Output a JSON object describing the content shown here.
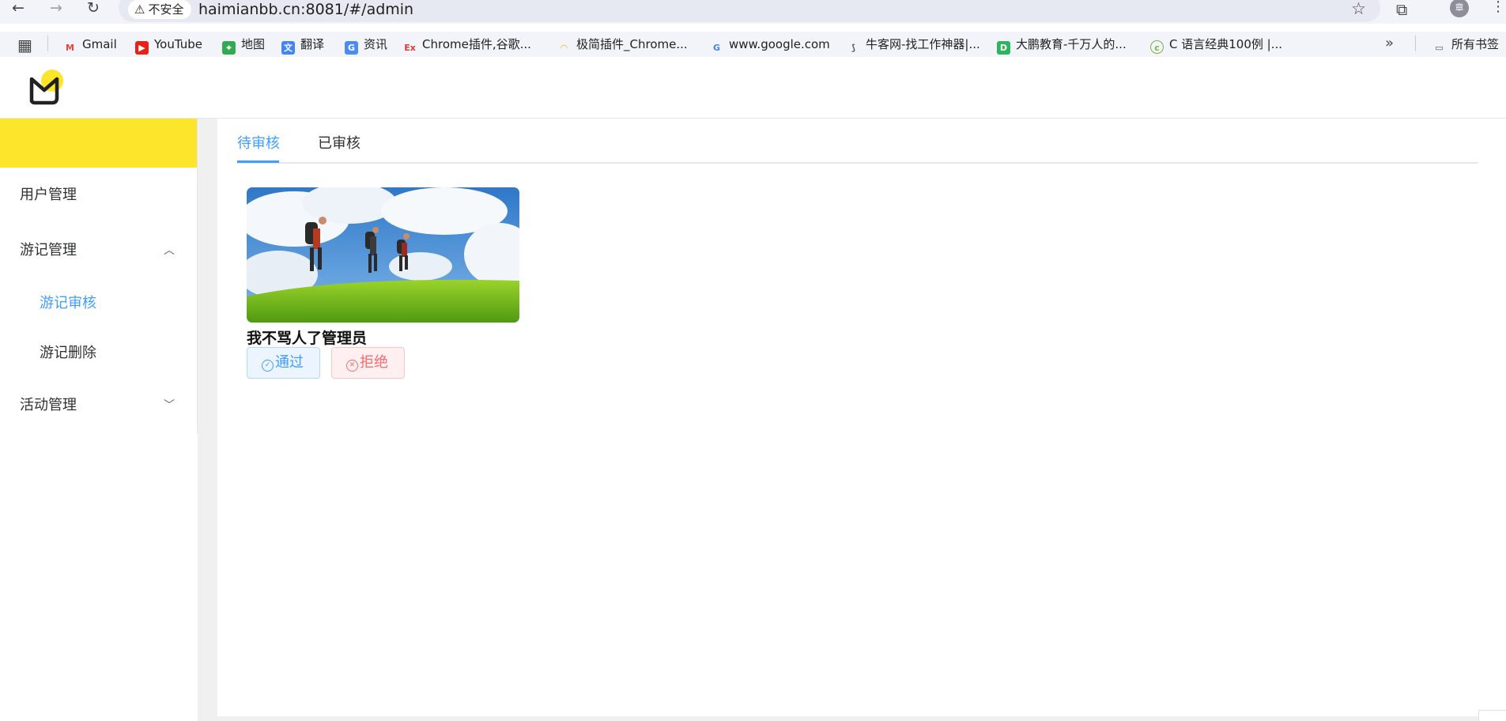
{
  "browser": {
    "security_label": "不安全",
    "url": "haimianbb.cn:8081/#/admin",
    "profile_initial": "章"
  },
  "bookmarks": {
    "items": [
      {
        "label": "Gmail"
      },
      {
        "label": "YouTube"
      },
      {
        "label": "地图"
      },
      {
        "label": "翻译"
      },
      {
        "label": "资讯"
      },
      {
        "label": "Chrome插件,谷歌..."
      },
      {
        "label": "极简插件_Chrome..."
      },
      {
        "label": "www.google.com"
      },
      {
        "label": "牛客网-找工作神器|..."
      },
      {
        "label": "大鹏教育-千万人的..."
      },
      {
        "label": "C 语言经典100例 |..."
      }
    ],
    "all_bookmarks_label": "所有书签"
  },
  "sidebar": {
    "items": [
      {
        "label": "用户管理"
      },
      {
        "label": "游记管理",
        "expanded": true
      },
      {
        "label": "游记审核",
        "active": true
      },
      {
        "label": "游记删除"
      },
      {
        "label": "活动管理",
        "expanded": false
      }
    ]
  },
  "tabs": [
    {
      "label": "待审核",
      "active": true
    },
    {
      "label": "已审核"
    }
  ],
  "card": {
    "author": "我不骂人了管理员",
    "approve_label": "通过",
    "reject_label": "拒绝"
  },
  "colors": {
    "accent": "#409eff",
    "brand_yellow": "#fde52b",
    "danger": "#f56c6c"
  }
}
